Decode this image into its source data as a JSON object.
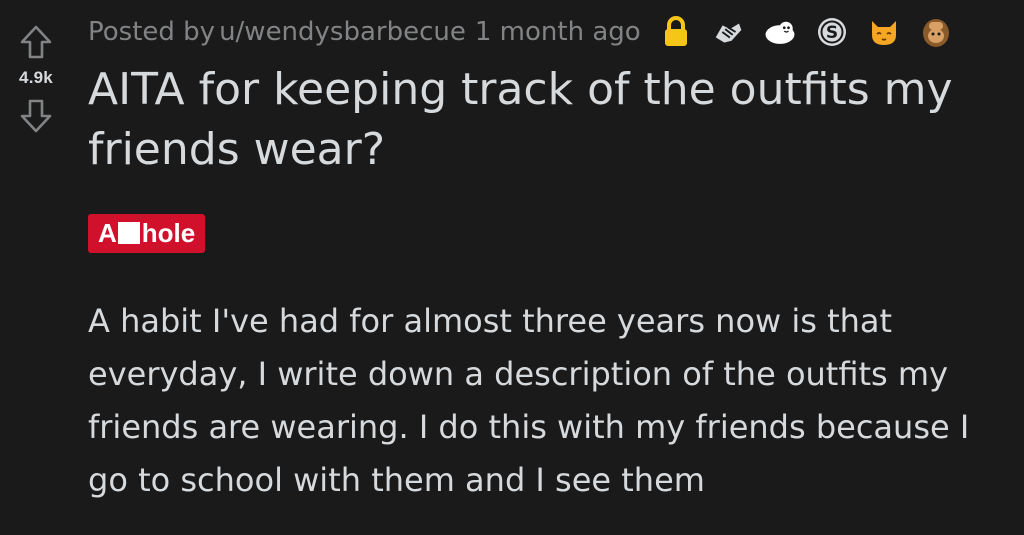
{
  "post": {
    "score": "4.9k",
    "meta": {
      "posted_by_label": "Posted by",
      "author": "u/wendysbarbecue",
      "age": "1 month ago"
    },
    "awards": [
      {
        "icon": "lock-icon",
        "color": "#f5c518"
      },
      {
        "icon": "handshake-award-icon",
        "color": "#d7dadc"
      },
      {
        "icon": "wholesome-seal-award-icon",
        "color": "#ffffff"
      },
      {
        "icon": "silver-s-award-icon",
        "color": "#d7dadc"
      },
      {
        "icon": "cat-award-icon",
        "color": "#f5a623"
      },
      {
        "icon": "facepalm-award-icon",
        "color": "#c07a3a"
      }
    ],
    "title": "AITA for keeping track of the outfits my friends wear?",
    "flair": {
      "prefix": "A",
      "suffix": "hole",
      "color": "#d1112c"
    },
    "body": "A habit I've had for almost three years now is that everyday, I write down a description of the outfits my friends are wearing. I do this with my friends because I go to school with them and I see them"
  }
}
